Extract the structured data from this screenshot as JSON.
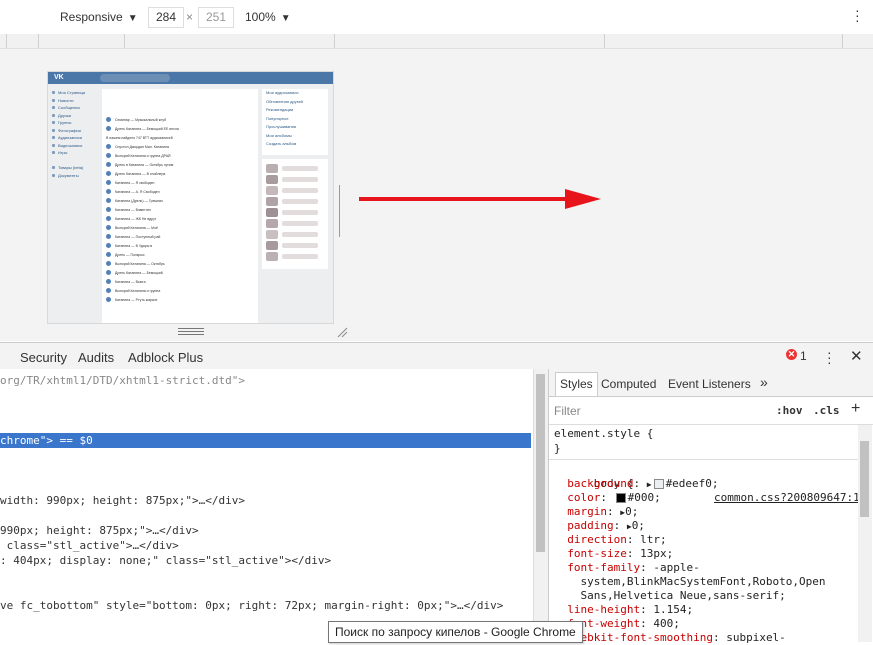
{
  "device_toolbar": {
    "device": "Responsive",
    "width": "284",
    "times": "×",
    "height": "251",
    "zoom": "100%"
  },
  "emulated_page": {
    "logo": "VK",
    "left_nav": [
      "Моя Страница",
      "Новости",
      "Сообщения",
      "Друзья",
      "Группы",
      "Фотографии",
      "Аудиозаписи",
      "Видеозаписи",
      "Игры",
      "",
      "Товары (beta)",
      "Документы"
    ],
    "tracks": [
      "Семинар — Музыкальный клуб",
      "Дрель Катанина — Бемоцкий ЕЕ ипсла",
      "В нашем найдено 747 ВТТ аудиозаписей",
      "Спустил Джордан Мал. Катанина",
      "Выпорий Катанина и группа ДРАЙ",
      "Дрель в Катанинa — Октябрь пугим",
      "Дрель Катанина — В спойлера",
      "Катанина — Я свободен",
      "Катанина — А. Я Свободен",
      "Катанина (Дрель) — Грешник",
      "Катанина — Взвинтил",
      "Катанина — ЖК Не вдруг",
      "Выпорий Катанина — Моё",
      "Катанина — Поступный рай",
      "Катанина — В Удары в",
      "Дрель — Полкрыс",
      "Выпорий Катанина — Октябрь",
      "Дрель Катанина — Бемоцкий",
      "Катанина — Вьюга",
      "Выпорий Катанина и группа",
      "Катанина — Ртуть жаркое"
    ],
    "right_menu": [
      "Мои аудиозаписи",
      "Обновления друзей",
      "Рекомендации",
      "Популярное",
      "Прослушивания",
      "Мои альбомы",
      "Создать альбом"
    ]
  },
  "devtools": {
    "tabs": [
      "Security",
      "Audits",
      "Adblock Plus"
    ],
    "error_count": "1",
    "close": "✕"
  },
  "elements_panel": {
    "lines": [
      {
        "text": "org/TR/xhtml1/DTD/xhtml1-strict.dtd\">",
        "kind": "doctype"
      },
      {
        "text": "chrome\"> == $0",
        "kind": "selected"
      },
      {
        "text": "width: 990px; height: 875px;\">…</div>",
        "kind": "code"
      },
      {
        "text": "990px; height: 875px;\">…</div>",
        "kind": "code"
      },
      {
        "text": " class=\"stl_active\">…</div>",
        "kind": "code"
      },
      {
        "text": ": 404px; display: none;\" class=\"stl_active\"></div>",
        "kind": "code"
      },
      {
        "text": "ve fc_tobottom\" style=\"bottom: 0px; right: 72px; margin-right: 0px;\">…</div>",
        "kind": "code"
      }
    ]
  },
  "styles_panel": {
    "tabs": [
      "Styles",
      "Computed",
      "Event Listeners"
    ],
    "more": "»",
    "filter_placeholder": "Filter",
    "hov": ":hov",
    "cls": ".cls",
    "element_style": "element.style {",
    "close_brace": "}",
    "rule_selector": "body {",
    "rule_source": "common.css?200809647:1",
    "declarations": [
      {
        "prop": "background",
        "value": "#edeef0;",
        "arrow": true,
        "swatch": "#edeef0"
      },
      {
        "prop": "color",
        "value": "#000;",
        "arrow": false,
        "swatch": "#000000"
      },
      {
        "prop": "margin",
        "value": "0;",
        "arrow": true,
        "swatch": ""
      },
      {
        "prop": "padding",
        "value": "0;",
        "arrow": true,
        "swatch": ""
      },
      {
        "prop": "direction",
        "value": "ltr;",
        "arrow": false,
        "swatch": ""
      },
      {
        "prop": "font-size",
        "value": "13px;",
        "arrow": false,
        "swatch": ""
      },
      {
        "prop": "font-family",
        "value": "-apple-",
        "arrow": false,
        "swatch": ""
      },
      {
        "prop": "",
        "value": "system,BlinkMacSystemFont,Roboto,Open",
        "arrow": false,
        "swatch": ""
      },
      {
        "prop": "",
        "value": "Sans,Helvetica Neue,sans-serif;",
        "arrow": false,
        "swatch": ""
      },
      {
        "prop": "line-height",
        "value": "1.154;",
        "arrow": false,
        "swatch": ""
      },
      {
        "prop": "font-weight",
        "value": "400;",
        "arrow": false,
        "swatch": ""
      },
      {
        "prop": "-webkit-font-smoothing",
        "value": "subpixel-",
        "arrow": false,
        "swatch": ""
      }
    ]
  },
  "tooltip": "Поиск по запросу кипелов - Google Chrome",
  "colors": {
    "accent_blue": "#3a77cc",
    "vk_blue": "#4a76a8",
    "arrow_red": "#e8141b",
    "error_red": "#e33333"
  }
}
